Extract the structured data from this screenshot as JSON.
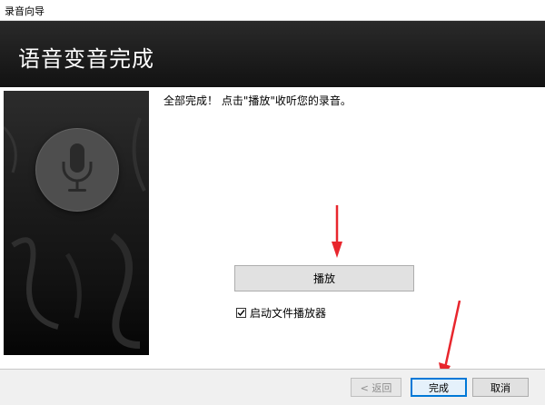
{
  "window": {
    "title": "录音向导"
  },
  "header": {
    "heading": "语音变音完成"
  },
  "main": {
    "message": "全部完成！ 点击\"播放\"收听您的录音。",
    "play_label": "播放",
    "checkbox": {
      "label": "启动文件播放器",
      "checked": true
    }
  },
  "footer": {
    "back_label": "< 返回",
    "finish_label": "完成",
    "cancel_label": "取消"
  },
  "icons": {
    "sidebar": "microphone-icon",
    "annotation": "red-arrow-icon",
    "check": "check-icon"
  },
  "colors": {
    "header_bg": "#1a1a1a",
    "arrow": "#e8262d",
    "finish_border": "#0078d7"
  }
}
